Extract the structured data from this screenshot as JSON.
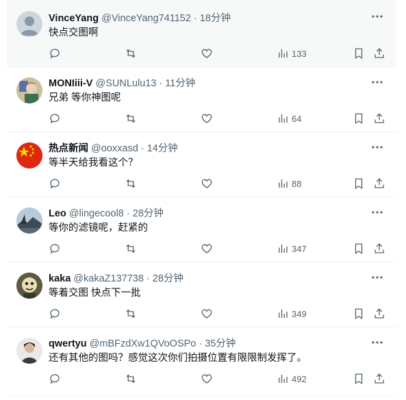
{
  "posts": [
    {
      "name": "VinceYang",
      "handle": "@VinceYang741152",
      "time": "18分钟",
      "text": "快点交图啊",
      "views": "133",
      "avatar": "default"
    },
    {
      "name": "MONIiii-V",
      "handle": "@SUNLulu13",
      "time": "11分钟",
      "text": "兄弟 等你神图呢",
      "views": "64",
      "avatar": "anime"
    },
    {
      "name": "热点新闻",
      "handle": "@ooxxasd",
      "time": "14分钟",
      "text": "等半天给我看这个？",
      "views": "88",
      "avatar": "flag"
    },
    {
      "name": "Leo",
      "handle": "@lingecool8",
      "time": "28分钟",
      "text": "等你的滤镜呢，赶紧的",
      "views": "347",
      "avatar": "landscape"
    },
    {
      "name": "kaka",
      "handle": "@kakaZ137738",
      "time": "28分钟",
      "text": "等着交图 快点下一批",
      "views": "349",
      "avatar": "cartoon"
    },
    {
      "name": "qwertyu",
      "handle": "@mBFzdXw1QVoOSPo",
      "time": "35分钟",
      "text": "还有其他的图吗？感觉这次你们拍摄位置有限限制发挥了。",
      "views": "492",
      "avatar": "person"
    }
  ],
  "icons": {
    "reply": "reply-icon",
    "repost": "repost-icon",
    "like": "like-icon",
    "views": "views-icon",
    "bookmark": "bookmark-icon",
    "share": "share-icon",
    "more": "more-icon"
  },
  "colors": {
    "secondary_text": "#536471",
    "primary_text": "#0f1419",
    "highlight_bg": "#f7f9f9",
    "divider": "#eff3f4"
  }
}
